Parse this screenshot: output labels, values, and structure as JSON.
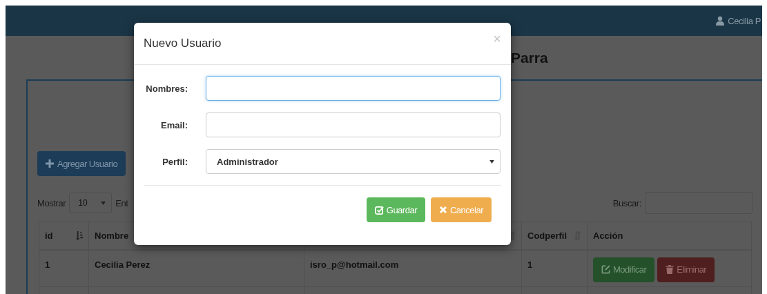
{
  "navbar": {
    "user": "Cecilia P"
  },
  "page_title": "Parra",
  "add_button": "Agregar Usuario",
  "show_label": "Mostrar",
  "page_size": "10",
  "entries_label": "Ent",
  "search": {
    "label": "Buscar:"
  },
  "table": {
    "columns": [
      {
        "label": "id",
        "sorted": true
      },
      {
        "label": "Nombre"
      },
      {
        "sorted": false
      },
      {
        "label": "Codperfil",
        "sorted": false
      },
      {
        "label": "Acción"
      }
    ],
    "rows": [
      {
        "cells": [
          "1",
          "Cecilia Perez",
          "isro_p@hotmail.com",
          "1"
        ],
        "actions": [
          {
            "label": "Modificar",
            "kind": "edit"
          },
          {
            "label": "Eliminar",
            "kind": "delete"
          }
        ]
      }
    ]
  },
  "modal": {
    "title": "Nuevo Usuario",
    "close": "×",
    "fields": [
      {
        "label": "Nombres:",
        "kind": "text",
        "focused": true
      },
      {
        "label": "Email:",
        "kind": "text",
        "focused": false
      },
      {
        "label": "Perfil:",
        "kind": "select",
        "value": "Administrador",
        "focused": false
      }
    ],
    "buttons": [
      {
        "label": "Guardar",
        "kind": "save"
      },
      {
        "label": "Cancelar",
        "kind": "cancel"
      }
    ]
  }
}
